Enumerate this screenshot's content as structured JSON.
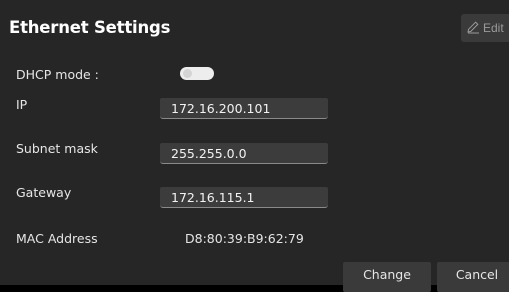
{
  "header": {
    "title": "Ethernet Settings",
    "edit_label": "Edit",
    "edit_icon": "pencil-icon"
  },
  "form": {
    "dhcp": {
      "label": "DHCP mode :",
      "enabled": false
    },
    "ip": {
      "label": "IP",
      "value": "172.16.200.101"
    },
    "subnet": {
      "label": "Subnet mask",
      "value": "255.255.0.0"
    },
    "gateway": {
      "label": "Gateway",
      "value": "172.16.115.1"
    },
    "mac": {
      "label": "MAC Address",
      "value": "D8:80:39:B9:62:79"
    }
  },
  "actions": {
    "change_label": "Change",
    "cancel_label": "Cancel"
  },
  "colors": {
    "panel_bg": "#262626",
    "field_bg": "#3c3c3c",
    "text": "#e6e6e6"
  }
}
